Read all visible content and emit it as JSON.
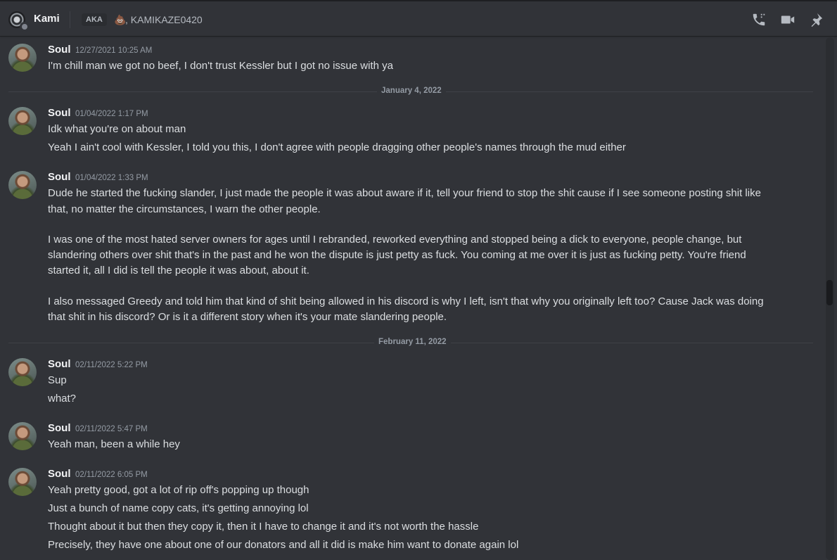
{
  "header": {
    "dm_name": "Kami",
    "aka_label": "AKA",
    "aka_icon": "poop-emoji-icon",
    "aka_names": ", KAMIKAZE0420",
    "buttons": [
      "phone-call-icon",
      "video-call-icon",
      "pin-icon"
    ]
  },
  "messages": [
    {
      "author": "Soul",
      "time": "12/27/2021 10:25 AM",
      "lines": [
        "I'm chill man we got no beef, I don't trust Kessler but I got no issue with ya"
      ]
    },
    {
      "separator": "January 4, 2022"
    },
    {
      "author": "Soul",
      "time": "01/04/2022 1:17 PM",
      "lines": [
        "Idk what you're on about man",
        "Yeah I ain't cool with Kessler, I told you this, I don't agree with people dragging other people's names through the mud either"
      ]
    },
    {
      "author": "Soul",
      "time": "01/04/2022 1:33 PM",
      "lines": [
        "Dude he started the fucking slander, I just made the people it was about aware if it, tell your friend to stop the shit cause if I see someone posting shit like",
        "that, no matter the circumstances, I warn the other people.",
        "I was one of the most hated server owners for ages until I rebranded, reworked everything and stopped being a dick to everyone, people change, but",
        "slandering others over shit that's in the past and he won the dispute is just petty as fuck. You coming at me over it is just as fucking petty. You're friend",
        "started it, all I did is tell the people it was about, about it.",
        "I also messaged Greedy and told him that kind of shit being allowed in his discord is why I left, isn't that why you originally left too? Cause Jack was doing",
        "that shit in his discord? Or is it a different story when it's your mate slandering people."
      ]
    },
    {
      "separator": "February 11, 2022"
    },
    {
      "author": "Soul",
      "time": "02/11/2022 5:22 PM",
      "lines": [
        "Sup",
        "what?"
      ]
    },
    {
      "author": "Soul",
      "time": "02/11/2022 5:47 PM",
      "lines": [
        "Yeah man, been a while hey"
      ]
    },
    {
      "author": "Soul",
      "time": "02/11/2022 6:05 PM",
      "lines": [
        "Yeah pretty good, got a lot of rip off's popping up though",
        "Just a bunch of name copy cats, it's getting annoying lol",
        "Thought about it but then they copy it, then it I have to change it and it's not worth the hassle",
        "Precisely, they have one about one of our donators and all it did is make him want to donate again lol"
      ]
    }
  ]
}
